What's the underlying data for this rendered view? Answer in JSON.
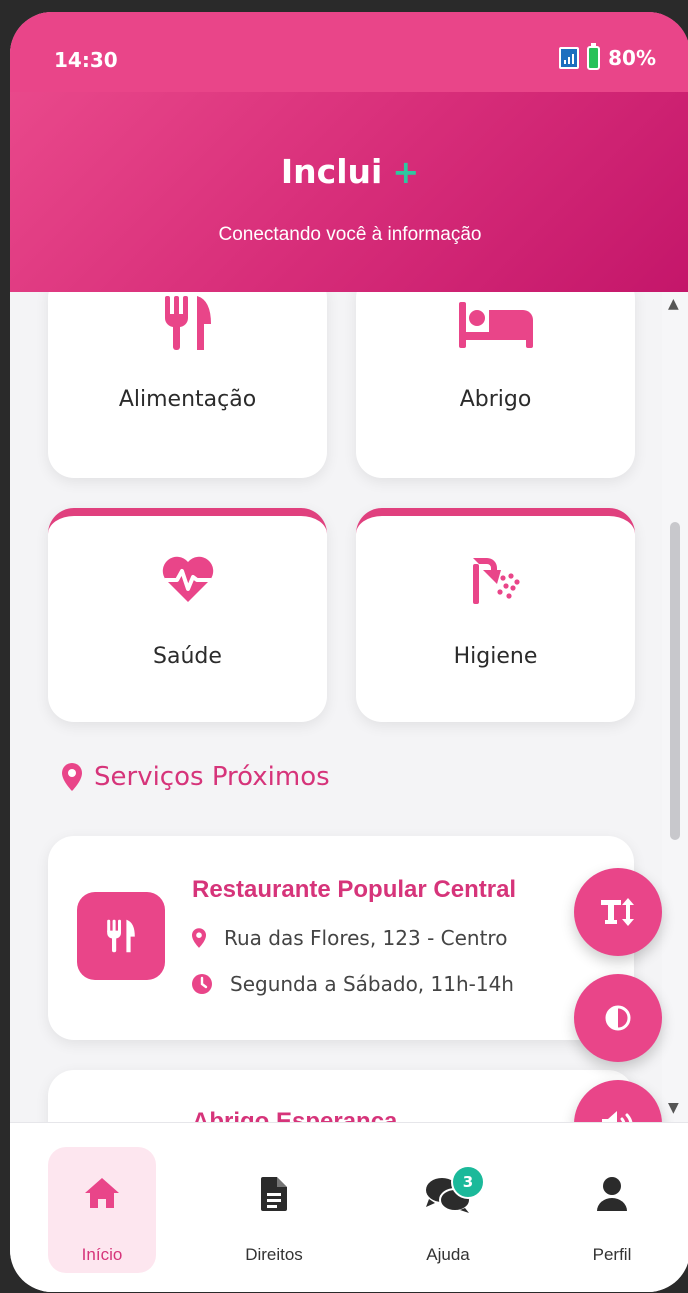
{
  "status_bar": {
    "time": "14:30",
    "battery_percent": "80%"
  },
  "header": {
    "title": "Inclui",
    "title_accent": "+",
    "subtitle": "Conectando você à informação"
  },
  "categories": [
    {
      "label": "Alimentação",
      "icon": "utensils-icon"
    },
    {
      "label": "Abrigo",
      "icon": "bed-icon"
    },
    {
      "label": "Saúde",
      "icon": "heartbeat-icon"
    },
    {
      "label": "Higiene",
      "icon": "shower-icon"
    }
  ],
  "section": {
    "title": "Serviços Próximos",
    "icon": "map-pin-icon"
  },
  "services": [
    {
      "name": "Restaurante Popular Central",
      "address": "Rua das Flores, 123 - Centro",
      "hours": "Segunda a Sábado, 11h-14h",
      "icon": "utensils-icon"
    },
    {
      "name": "Abrigo Esperança"
    }
  ],
  "fabs": [
    {
      "name": "text-size",
      "icon": "text-height-icon"
    },
    {
      "name": "contrast",
      "icon": "contrast-icon"
    },
    {
      "name": "audio",
      "icon": "volume-icon"
    }
  ],
  "nav": {
    "items": [
      {
        "label": "Início",
        "icon": "home-icon",
        "active": true
      },
      {
        "label": "Direitos",
        "icon": "document-icon"
      },
      {
        "label": "Ajuda",
        "icon": "comments-icon",
        "badge": "3"
      },
      {
        "label": "Perfil",
        "icon": "user-icon"
      }
    ]
  },
  "colors": {
    "primary": "#e94589",
    "accent": "#2fc7a0",
    "badge": "#1bb99a"
  }
}
